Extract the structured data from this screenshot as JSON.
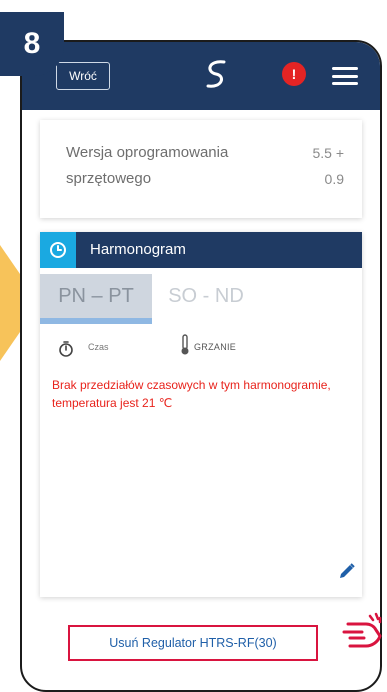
{
  "step": {
    "number": "8"
  },
  "header": {
    "back_label": "Wróć",
    "logo_icon": "swirl-logo-icon",
    "alert_symbol": "!",
    "menu_icon": "hamburger-menu-icon"
  },
  "firmware": {
    "label": "Wersja oprogramowania sprzętowego",
    "value": "5.5 +\n0.9"
  },
  "schedule": {
    "title": "Harmonogram",
    "icon": "clock-icon",
    "tabs": [
      {
        "label": "PN – PT",
        "active": true
      },
      {
        "label": "SO - ND",
        "active": false
      }
    ],
    "time_label": "Czas",
    "mode_label": "GRZANIE",
    "empty_message": "Brak przedziałów czasowych w tym harmonogramie, temperatura jest 21 ℃"
  },
  "footer": {
    "remove_label": "Usuń Regulator HTRS-RF(30)"
  },
  "colors": {
    "primary": "#1f3a63",
    "accent": "#1aa9e1",
    "alert": "#e42424",
    "warning_text": "#e8231c",
    "highlight_border": "#d9143f",
    "side_arrow": "#f7c35a"
  }
}
